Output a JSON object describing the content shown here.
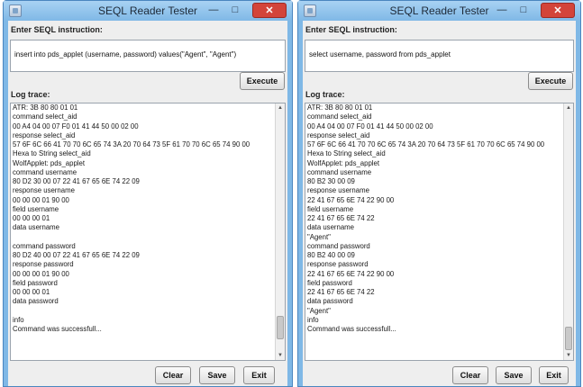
{
  "windows": [
    {
      "title": "SEQL Reader Tester",
      "instruction_label": "Enter SEQL instruction:",
      "instruction_value": "insert into pds_applet (username, password) values(\"Agent\", \"Agent\")",
      "execute_label": "Execute",
      "log_label": "Log trace:",
      "log_lines": [
        "ATR: 3B 80 80 01 01",
        "command select_aid",
        "00 A4 04 00 07 F0 01 41 44 50 00 02 00",
        "response select_aid",
        "57 6F 6C 66 41 70 70 6C 65 74 3A 20 70 64 73 5F 61 70 70 6C 65 74 90 00",
        "Hexa to String select_aid",
        "WolfApplet: pds_applet",
        "command username",
        "80 D2 30 00 07 22 41 67 65 6E 74 22 09",
        "response username",
        "00 00 00 01 90 00",
        "field username",
        "00 00 00 01",
        "data username",
        "",
        "command password",
        "80 D2 40 00 07 22 41 67 65 6E 74 22 09",
        "response password",
        "00 00 00 01 90 00",
        "field password",
        "00 00 00 01",
        "data password",
        "",
        "info",
        "Command was successfull..."
      ],
      "clear_label": "Clear",
      "save_label": "Save",
      "exit_label": "Exit",
      "scroll_position": 0.95
    },
    {
      "title": "SEQL Reader Tester",
      "instruction_label": "Enter SEQL instruction:",
      "instruction_value": "select username, password  from pds_applet",
      "execute_label": "Execute",
      "log_label": "Log trace:",
      "log_lines": [
        "ATR: 3B 80 80 01 01",
        "command select_aid",
        "00 A4 04 00 07 F0 01 41 44 50 00 02 00",
        "response select_aid",
        "57 6F 6C 66 41 70 70 6C 65 74 3A 20 70 64 73 5F 61 70 70 6C 65 74 90 00",
        "Hexa to String select_aid",
        "WolfApplet: pds_applet",
        "command username",
        "80 B2 30 00 09",
        "response username",
        "22 41 67 65 6E 74 22 90 00",
        "field username",
        "22 41 67 65 6E 74 22",
        "data username",
        "\"Agent\"",
        "command password",
        "80 B2 40 00 09",
        "response password",
        "22 41 67 65 6E 74 22 90 00",
        "field password",
        "22 41 67 65 6E 74 22",
        "data password",
        "\"Agent\"",
        "info",
        "Command was successfull..."
      ],
      "clear_label": "Clear",
      "save_label": "Save",
      "exit_label": "Exit",
      "scroll_position": 1.0
    }
  ],
  "icons": {
    "app": "java-app-icon",
    "minimize": "minimize-icon",
    "maximize": "maximize-icon",
    "close": "close-icon"
  },
  "colors": {
    "title_bar": "#7fb8e6",
    "close_button": "#d3443a",
    "panel": "#eeeeee"
  }
}
